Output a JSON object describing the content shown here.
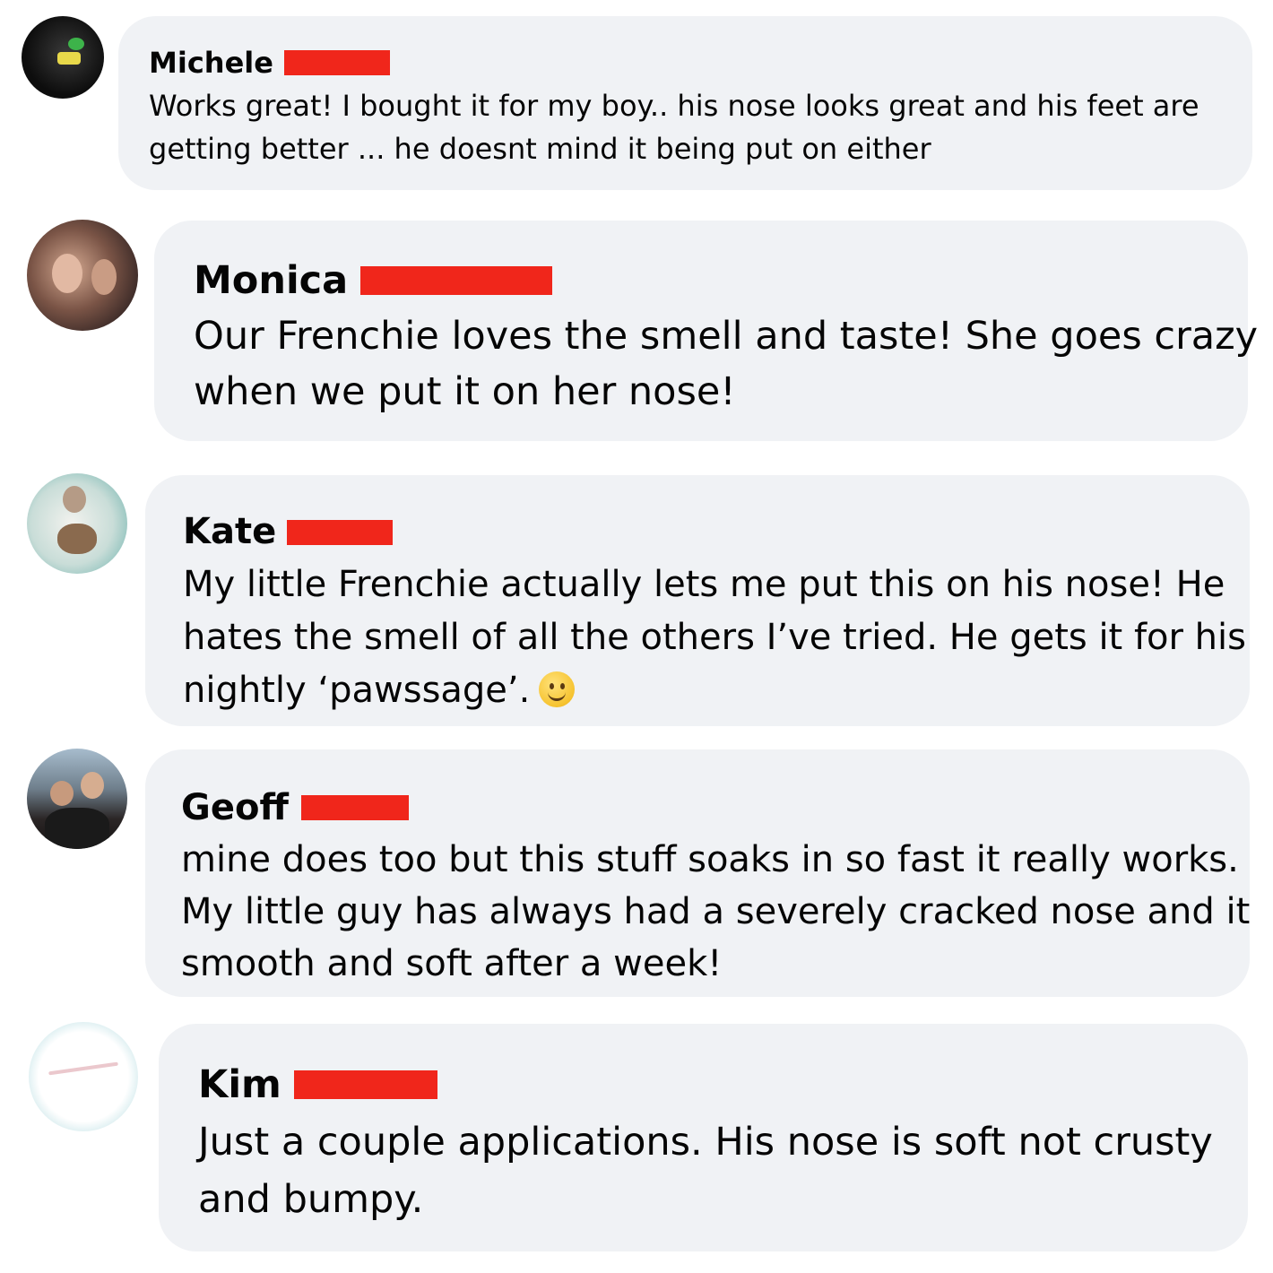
{
  "comments": [
    {
      "name": "Michele",
      "lines": [
        "Works great! I bought it for my boy.. his nose looks great and his feet are",
        "getting better ... he doesnt mind it being put on either"
      ]
    },
    {
      "name": "Monica",
      "lines": [
        "Our Frenchie loves the smell and taste! She goes crazy",
        "when we put it on her nose!"
      ]
    },
    {
      "name": "Kate",
      "lines": [
        "My little Frenchie actually lets me put this on his nose! He",
        "hates the smell of all the others I’ve tried. He gets it for his",
        "nightly ‘pawssage’."
      ],
      "emoji": "slightly-smiling-face-icon"
    },
    {
      "name": "Geoff",
      "lines": [
        "mine does too but this stuff soaks in so fast it really works.",
        "My little guy has always had a severely cracked nose and it",
        "smooth and soft after a week!"
      ]
    },
    {
      "name": "Kim",
      "lines": [
        "Just a couple applications. His nose is soft not crusty",
        "and bumpy."
      ]
    }
  ],
  "colors": {
    "bubble": "#f0f2f5",
    "text": "#050505",
    "redaction": "#f0261b"
  }
}
